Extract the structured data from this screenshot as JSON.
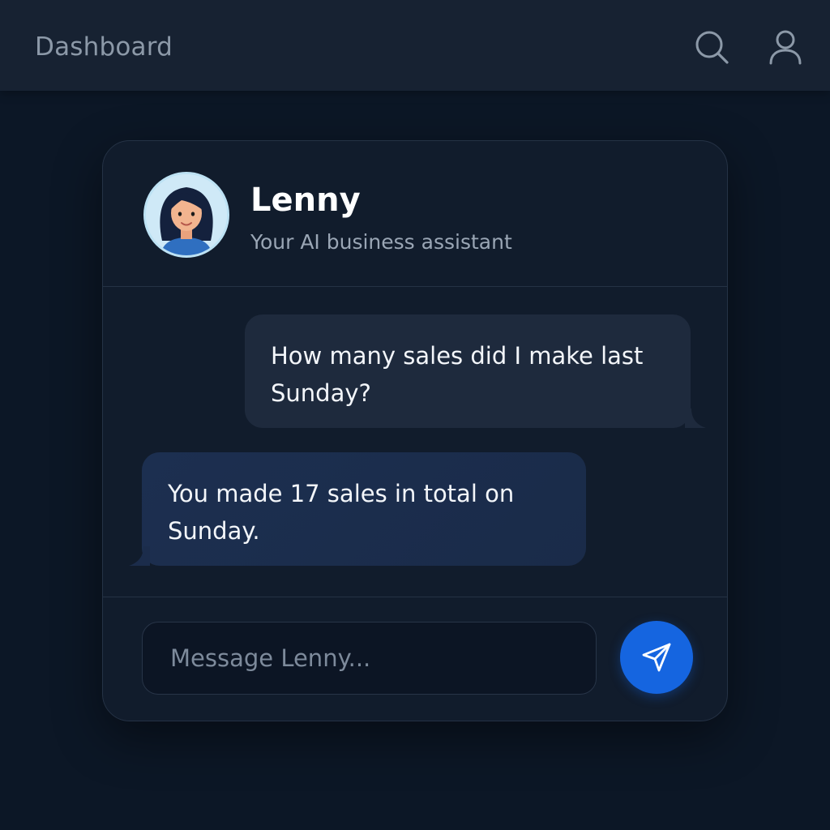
{
  "header": {
    "title": "Dashboard",
    "search_icon": "search-icon",
    "profile_icon": "user-profile-icon"
  },
  "chat": {
    "assistant": {
      "name": "Lenny",
      "subtitle": "Your AI business assistant",
      "avatar_icon": "assistant-avatar"
    },
    "messages": [
      {
        "sender": "user",
        "text": "How many sales did I make last Sunday?"
      },
      {
        "sender": "assistant",
        "text": "You made 17 sales in total on Sunday."
      }
    ],
    "composer": {
      "placeholder": "Message Lenny...",
      "value": "",
      "send_icon": "send-icon"
    }
  },
  "colors": {
    "background": "#0c1726",
    "topbar": "#172232",
    "card": "#111c2c",
    "user_bubble": "#1e2a3d",
    "assistant_bubble": "#1c2f50",
    "accent": "#1565e0"
  }
}
